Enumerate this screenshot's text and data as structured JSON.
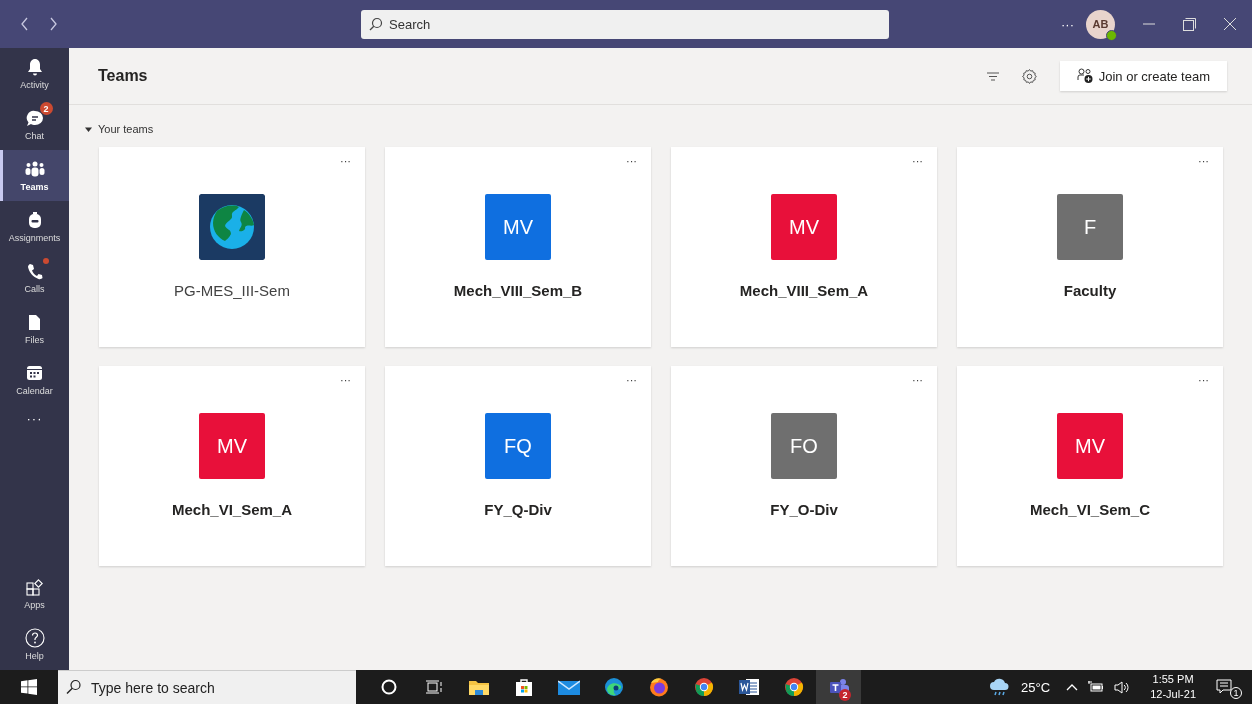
{
  "title_bar": {
    "search": {
      "placeholder": "Search"
    },
    "more": "···",
    "avatar": {
      "initials": "AB",
      "online": true
    }
  },
  "sidebar": {
    "items": [
      {
        "kind": "activity",
        "label": "Activity",
        "selected": false
      },
      {
        "kind": "chat",
        "label": "Chat",
        "selected": false,
        "badge": "2"
      },
      {
        "kind": "teams",
        "label": "Teams",
        "selected": true
      },
      {
        "kind": "assignments",
        "label": "Assignments",
        "selected": false
      },
      {
        "kind": "calls",
        "label": "Calls",
        "selected": false,
        "dot": true
      },
      {
        "kind": "files",
        "label": "Files",
        "selected": false
      },
      {
        "kind": "calendar",
        "label": "Calendar",
        "selected": false
      }
    ],
    "more": "···",
    "bottom_items": [
      {
        "kind": "apps",
        "label": "Apps",
        "selected": false
      },
      {
        "kind": "help",
        "label": "Help",
        "selected": false
      }
    ]
  },
  "header": {
    "title": "Teams",
    "join_button": "Join or create team"
  },
  "section": {
    "label": "Your teams",
    "expanded": true
  },
  "teams": [
    {
      "name": "PG-MES_III-Sem",
      "kind": "image",
      "unread": false,
      "more": "···"
    },
    {
      "name": "Mech_VIII_Sem_B",
      "kind": "initials",
      "initials": "MV",
      "color": "#0f6fe0",
      "unread": true,
      "more": "···"
    },
    {
      "name": "Mech_VIII_Sem_A",
      "kind": "initials",
      "initials": "MV",
      "color": "#e8103a",
      "unread": true,
      "more": "···"
    },
    {
      "name": "Faculty",
      "kind": "initials",
      "initials": "F",
      "color": "#6f6f6f",
      "unread": true,
      "more": "···"
    },
    {
      "name": "Mech_VI_Sem_A",
      "kind": "initials",
      "initials": "MV",
      "color": "#e8103a",
      "unread": true,
      "more": "···"
    },
    {
      "name": "FY_Q-Div",
      "kind": "initials",
      "initials": "FQ",
      "color": "#0f6fe0",
      "unread": true,
      "more": "···"
    },
    {
      "name": "FY_O-Div",
      "kind": "initials",
      "initials": "FO",
      "color": "#6f6f6f",
      "unread": true,
      "more": "···"
    },
    {
      "name": "Mech_VI_Sem_C",
      "kind": "initials",
      "initials": "MV",
      "color": "#e8103a",
      "unread": true,
      "more": "···"
    }
  ],
  "taskbar": {
    "search": {
      "placeholder": "Type here to search"
    },
    "apps": [
      {
        "kind": "cortana",
        "selected": false
      },
      {
        "kind": "taskview",
        "selected": false
      },
      {
        "kind": "explorer",
        "selected": false
      },
      {
        "kind": "store",
        "selected": false
      },
      {
        "kind": "mail",
        "selected": false
      },
      {
        "kind": "edge",
        "selected": false
      },
      {
        "kind": "firefox",
        "selected": false
      },
      {
        "kind": "chrome",
        "selected": false
      },
      {
        "kind": "word",
        "selected": false
      },
      {
        "kind": "chrome",
        "selected": false
      },
      {
        "kind": "teams",
        "selected": true,
        "badge": "2"
      }
    ],
    "weather": "25°C",
    "time": "1:55 PM",
    "date": "12-Jul-21",
    "notifications": "1"
  }
}
